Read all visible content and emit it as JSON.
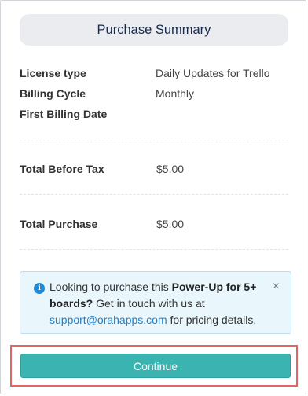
{
  "header": {
    "title": "Purchase Summary"
  },
  "details": {
    "license_type_label": "License type",
    "license_type_value": "Daily Updates for Trello",
    "billing_cycle_label": "Billing Cycle",
    "billing_cycle_value": "Monthly",
    "first_billing_label": "First Billing Date",
    "first_billing_value": ""
  },
  "totals": {
    "before_tax_label": "Total Before Tax",
    "before_tax_value": "$5.00",
    "purchase_label": "Total Purchase",
    "purchase_value": "$5.00"
  },
  "info": {
    "icon": "info-icon",
    "text_1": "Looking to purchase this ",
    "text_bold": "Power-Up for 5+ boards?",
    "text_2": " Get in touch with us at ",
    "link": "support@orahapps.com",
    "text_3": " for pricing details.",
    "close_glyph": "×"
  },
  "actions": {
    "continue_label": "Continue"
  },
  "colors": {
    "accent": "#3bb3b0",
    "link": "#1f7fc8",
    "highlight": "#e06663",
    "info_bg": "#e9f6fc"
  }
}
